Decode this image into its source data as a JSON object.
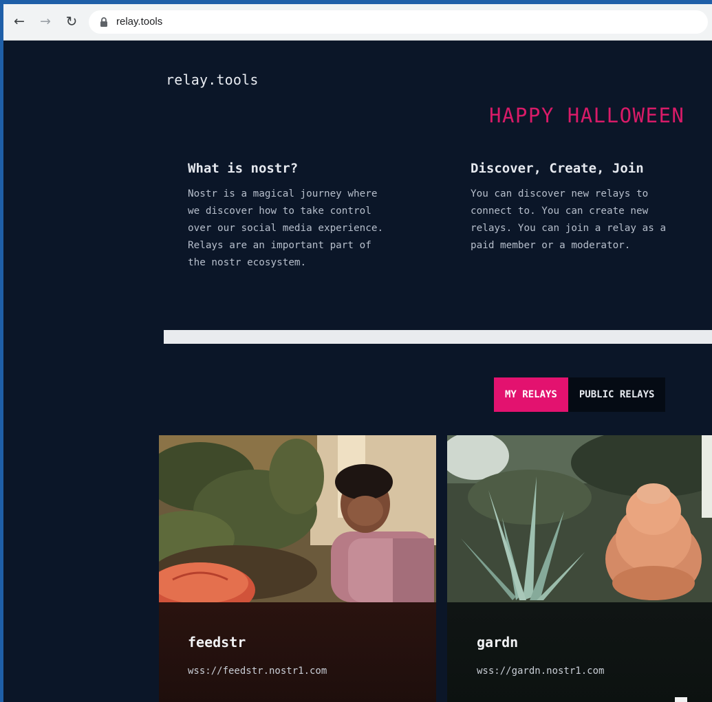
{
  "browser": {
    "url": "relay.tools",
    "back_glyph": "←",
    "forward_glyph": "→",
    "reload_glyph": "↻"
  },
  "site": {
    "logo": "relay.tools",
    "banner": "HAPPY HALLOWEEN"
  },
  "info": [
    {
      "title": "What is nostr?",
      "body": "Nostr is a magical journey where\nwe discover how to take control\nover our social media experience.\nRelays are an important part of\nthe nostr ecosystem."
    },
    {
      "title": "Discover, Create, Join",
      "body": "You can discover new relays to\nconnect to. You can create new\nrelays. You can join a relay as a\npaid member or a moderator."
    }
  ],
  "search": {
    "placeholder": ""
  },
  "tabs": [
    {
      "label": "MY RELAYS",
      "active": true
    },
    {
      "label": "PUBLIC RELAYS",
      "active": false
    }
  ],
  "relays": [
    {
      "name": "feedstr",
      "url": "wss://feedstr.nostr1.com"
    },
    {
      "name": "gardn",
      "url": "wss://gardn.nostr1.com"
    }
  ],
  "colors": {
    "page_bg": "#0b1628",
    "accent": "#e3126f",
    "banner": "#d81b68"
  }
}
